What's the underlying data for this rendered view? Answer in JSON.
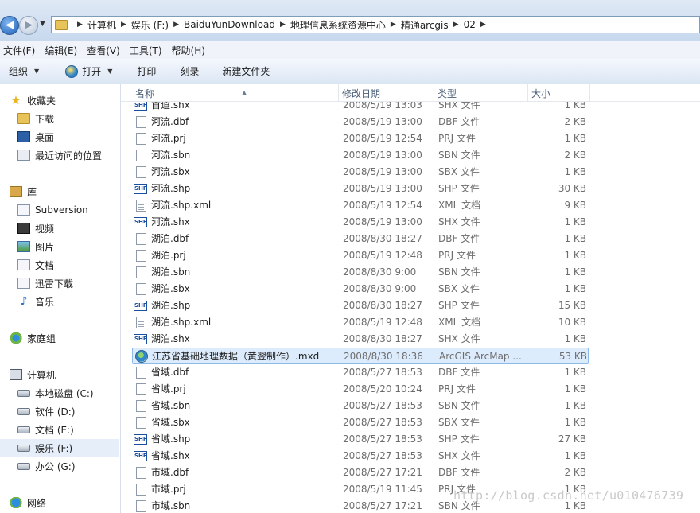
{
  "address": {
    "crumbs": [
      "计算机",
      "娱乐 (F:)",
      "BaiduYunDownload",
      "地理信息系统资源中心",
      "精通arcgis",
      "02"
    ]
  },
  "menu": [
    "文件(F)",
    "编辑(E)",
    "查看(V)",
    "工具(T)",
    "帮助(H)"
  ],
  "toolbar": {
    "organize": "组织",
    "open": "打开",
    "print": "打印",
    "burn": "刻录",
    "new_folder": "新建文件夹"
  },
  "nav": {
    "favorites": "收藏夹",
    "downloads": "下载",
    "desktop": "桌面",
    "recent": "最近访问的位置",
    "libraries": "库",
    "subversion": "Subversion",
    "videos": "视频",
    "pictures": "图片",
    "documents": "文档",
    "thunder": "迅雷下载",
    "music": "音乐",
    "homegroup": "家庭组",
    "computer": "计算机",
    "drive_c": "本地磁盘 (C:)",
    "drive_d": "软件 (D:)",
    "drive_e": "文档 (E:)",
    "drive_f": "娱乐 (F:)",
    "drive_g": "办公 (G:)",
    "network": "网络"
  },
  "columns": {
    "name": "名称",
    "date": "修改日期",
    "type": "类型",
    "size": "大小"
  },
  "files": [
    {
      "name": "首道.shx",
      "date": "2008/5/19 13:03",
      "type": "SHX 文件",
      "size": "1 KB",
      "icon": "shp"
    },
    {
      "name": "河流.dbf",
      "date": "2008/5/19 13:00",
      "type": "DBF 文件",
      "size": "2 KB",
      "icon": "plain"
    },
    {
      "name": "河流.prj",
      "date": "2008/5/19 12:54",
      "type": "PRJ 文件",
      "size": "1 KB",
      "icon": "plain"
    },
    {
      "name": "河流.sbn",
      "date": "2008/5/19 13:00",
      "type": "SBN 文件",
      "size": "2 KB",
      "icon": "plain"
    },
    {
      "name": "河流.sbx",
      "date": "2008/5/19 13:00",
      "type": "SBX 文件",
      "size": "1 KB",
      "icon": "plain"
    },
    {
      "name": "河流.shp",
      "date": "2008/5/19 13:00",
      "type": "SHP 文件",
      "size": "30 KB",
      "icon": "shp"
    },
    {
      "name": "河流.shp.xml",
      "date": "2008/5/19 12:54",
      "type": "XML 文档",
      "size": "9 KB",
      "icon": "xml"
    },
    {
      "name": "河流.shx",
      "date": "2008/5/19 13:00",
      "type": "SHX 文件",
      "size": "1 KB",
      "icon": "shp"
    },
    {
      "name": "湖泊.dbf",
      "date": "2008/8/30 18:27",
      "type": "DBF 文件",
      "size": "1 KB",
      "icon": "plain"
    },
    {
      "name": "湖泊.prj",
      "date": "2008/5/19 12:48",
      "type": "PRJ 文件",
      "size": "1 KB",
      "icon": "plain"
    },
    {
      "name": "湖泊.sbn",
      "date": "2008/8/30 9:00",
      "type": "SBN 文件",
      "size": "1 KB",
      "icon": "plain"
    },
    {
      "name": "湖泊.sbx",
      "date": "2008/8/30 9:00",
      "type": "SBX 文件",
      "size": "1 KB",
      "icon": "plain"
    },
    {
      "name": "湖泊.shp",
      "date": "2008/8/30 18:27",
      "type": "SHP 文件",
      "size": "15 KB",
      "icon": "shp"
    },
    {
      "name": "湖泊.shp.xml",
      "date": "2008/5/19 12:48",
      "type": "XML 文档",
      "size": "10 KB",
      "icon": "xml"
    },
    {
      "name": "湖泊.shx",
      "date": "2008/8/30 18:27",
      "type": "SHX 文件",
      "size": "1 KB",
      "icon": "shp"
    },
    {
      "name": "江苏省基础地理数据（黄翌制作）.mxd",
      "date": "2008/8/30 18:36",
      "type": "ArcGIS ArcMap ...",
      "size": "53 KB",
      "icon": "mxd",
      "selected": true
    },
    {
      "name": "省域.dbf",
      "date": "2008/5/27 18:53",
      "type": "DBF 文件",
      "size": "1 KB",
      "icon": "plain"
    },
    {
      "name": "省域.prj",
      "date": "2008/5/20 10:24",
      "type": "PRJ 文件",
      "size": "1 KB",
      "icon": "plain"
    },
    {
      "name": "省域.sbn",
      "date": "2008/5/27 18:53",
      "type": "SBN 文件",
      "size": "1 KB",
      "icon": "plain"
    },
    {
      "name": "省域.sbx",
      "date": "2008/5/27 18:53",
      "type": "SBX 文件",
      "size": "1 KB",
      "icon": "plain"
    },
    {
      "name": "省域.shp",
      "date": "2008/5/27 18:53",
      "type": "SHP 文件",
      "size": "27 KB",
      "icon": "shp"
    },
    {
      "name": "省域.shx",
      "date": "2008/5/27 18:53",
      "type": "SHX 文件",
      "size": "1 KB",
      "icon": "shp"
    },
    {
      "name": "市域.dbf",
      "date": "2008/5/27 17:21",
      "type": "DBF 文件",
      "size": "2 KB",
      "icon": "plain"
    },
    {
      "name": "市域.prj",
      "date": "2008/5/19 11:45",
      "type": "PRJ 文件",
      "size": "1 KB",
      "icon": "plain"
    },
    {
      "name": "市域.sbn",
      "date": "2008/5/27 17:21",
      "type": "SBN 文件",
      "size": "1 KB",
      "icon": "plain"
    }
  ],
  "watermark": "http://blog.csdn.net/u010476739",
  "colors": {
    "selection": "#ddecfd",
    "selection_border": "#8dbbe9",
    "toolbar": "#dbe6f4"
  }
}
